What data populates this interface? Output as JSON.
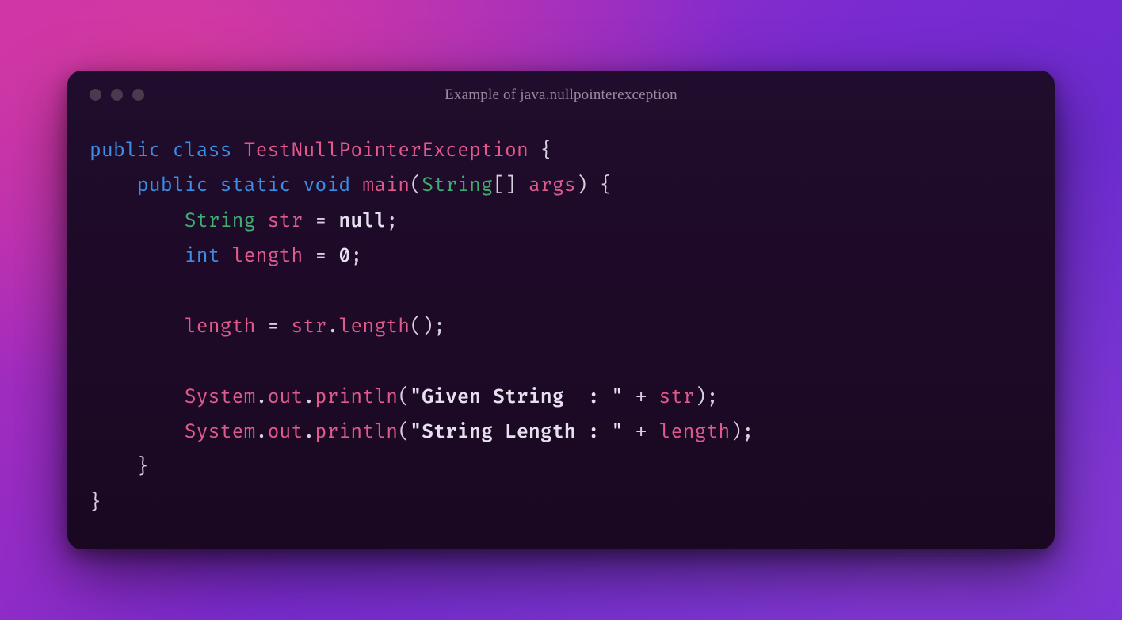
{
  "title": "Example of java.nullpointerexception",
  "tokens": {
    "public": "public",
    "class": "class",
    "static": "static",
    "void": "void",
    "int": "int",
    "String": "String",
    "null": "null",
    "zero": "0",
    "className": "TestNullPointerException",
    "main": "main",
    "args": "args",
    "str": "str",
    "length": "length",
    "System": "System",
    "out": "out",
    "println": "println",
    "str1": "\"Given String  : \"",
    "str2": "\"String Length : \""
  }
}
